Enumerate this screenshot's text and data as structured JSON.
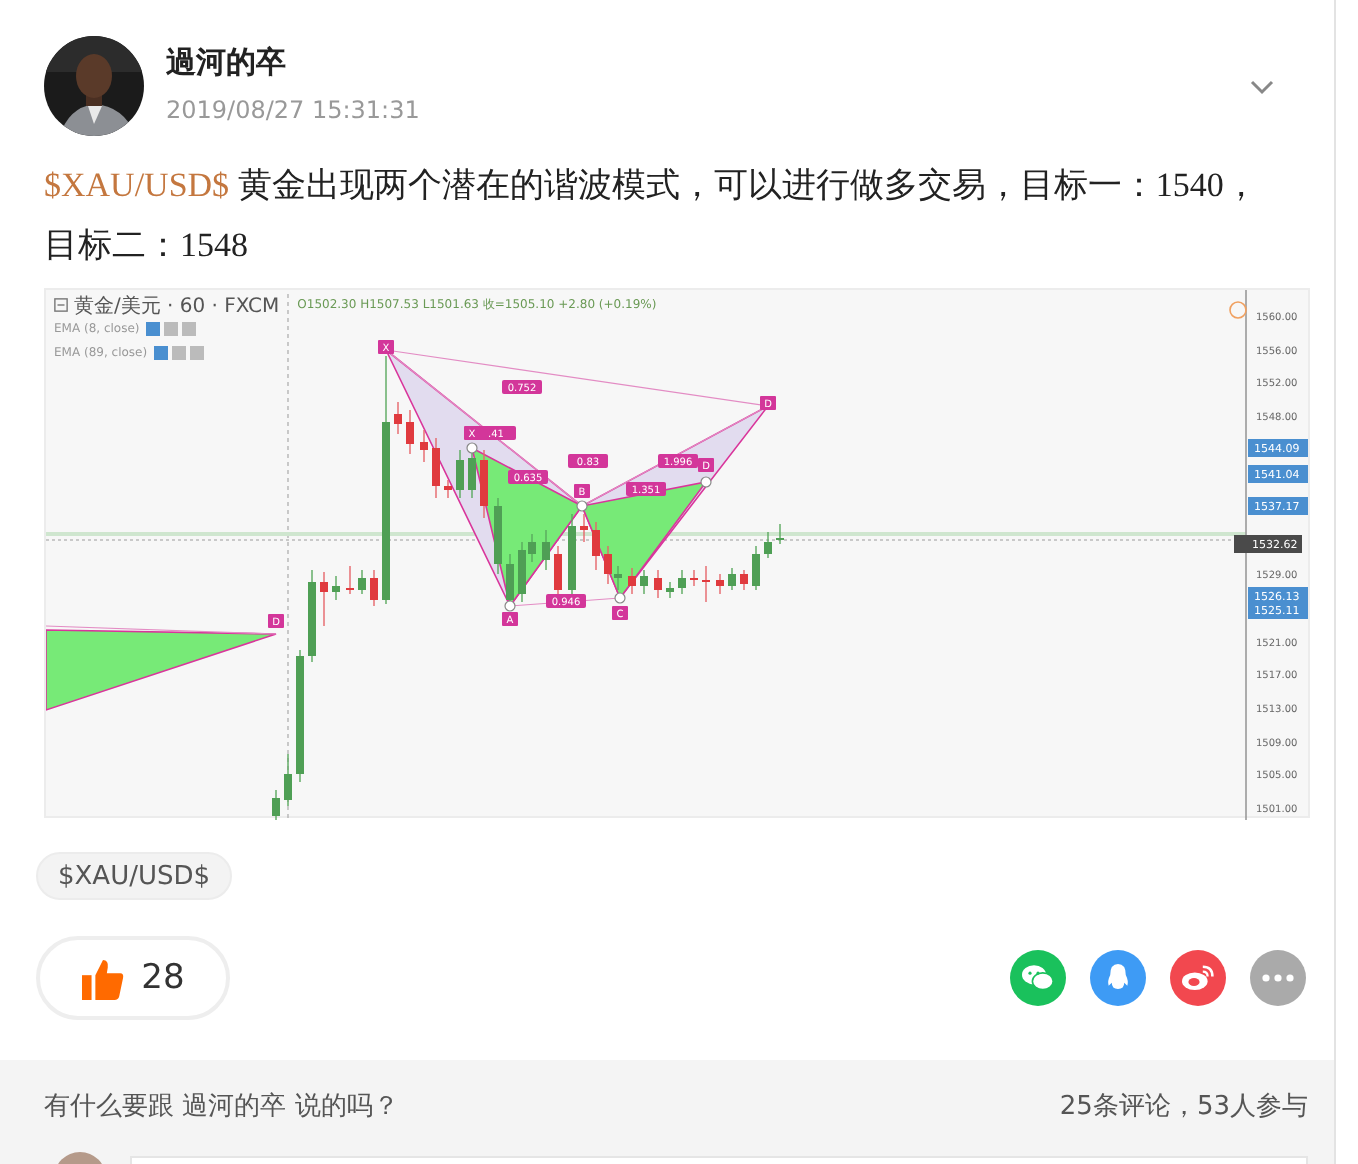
{
  "post": {
    "author": "過河的卒",
    "time": "2019/08/27 15:31:31",
    "link": "$XAU/USD$",
    "text": "黄金出现两个潜在的谐波模式，可以进行做多交易，目标一：1540，目标二：1548"
  },
  "chart": {
    "symbol": "黄金/美元 · 60 · FXCM",
    "quote": "O1502.30  H1507.53  L1501.63  收=1505.10  +2.80 (+0.19%)",
    "indicators": [
      "EMA (8, close)",
      "EMA (89, close)"
    ],
    "pattern_labels": [
      {
        "text": "X",
        "kind": "point"
      },
      {
        "text": "X",
        "kind": "point"
      },
      {
        "text": ".41",
        "kind": "ratio"
      },
      {
        "text": "0.752",
        "kind": "ratio"
      },
      {
        "text": "0.635",
        "kind": "ratio"
      },
      {
        "text": "B",
        "kind": "point"
      },
      {
        "text": "0.83",
        "kind": "ratio"
      },
      {
        "text": "1.996",
        "kind": "ratio"
      },
      {
        "text": "1.351",
        "kind": "ratio"
      },
      {
        "text": "D",
        "kind": "point"
      },
      {
        "text": "D",
        "kind": "point"
      },
      {
        "text": "A",
        "kind": "point"
      },
      {
        "text": "0.946",
        "kind": "ratio"
      },
      {
        "text": "C",
        "kind": "point"
      },
      {
        "text": "D",
        "kind": "point"
      }
    ],
    "price_scale": [
      {
        "label": "1560.00",
        "kind": "tick"
      },
      {
        "label": "1556.00",
        "kind": "tick"
      },
      {
        "label": "1552.00",
        "kind": "tick"
      },
      {
        "label": "1548.00",
        "kind": "tick"
      },
      {
        "label": "1544.09",
        "kind": "marker"
      },
      {
        "label": "1541.04",
        "kind": "marker"
      },
      {
        "label": "1537.17",
        "kind": "marker"
      },
      {
        "label": "1532.62",
        "kind": "current"
      },
      {
        "label": "1529.00",
        "kind": "tick"
      },
      {
        "label": "1526.13",
        "kind": "marker"
      },
      {
        "label": "1525.11",
        "kind": "marker"
      },
      {
        "label": "1521.00",
        "kind": "tick"
      },
      {
        "label": "1517.00",
        "kind": "tick"
      },
      {
        "label": "1513.00",
        "kind": "tick"
      },
      {
        "label": "1509.00",
        "kind": "tick"
      },
      {
        "label": "1505.00",
        "kind": "tick"
      },
      {
        "label": "1501.00",
        "kind": "tick"
      }
    ]
  },
  "tags": [
    "$XAU/USD$"
  ],
  "likes": "28",
  "share": [
    {
      "kind": "wechat",
      "color": "#1ac15c"
    },
    {
      "kind": "qq",
      "color": "#3e9bf5"
    },
    {
      "kind": "weibo",
      "color": "#f2484f"
    },
    {
      "kind": "more",
      "color": "#aaaaaa"
    }
  ],
  "comments": {
    "prompt": "有什么要跟 過河的卒 说的吗？",
    "count": "25条评论，53人参与"
  }
}
